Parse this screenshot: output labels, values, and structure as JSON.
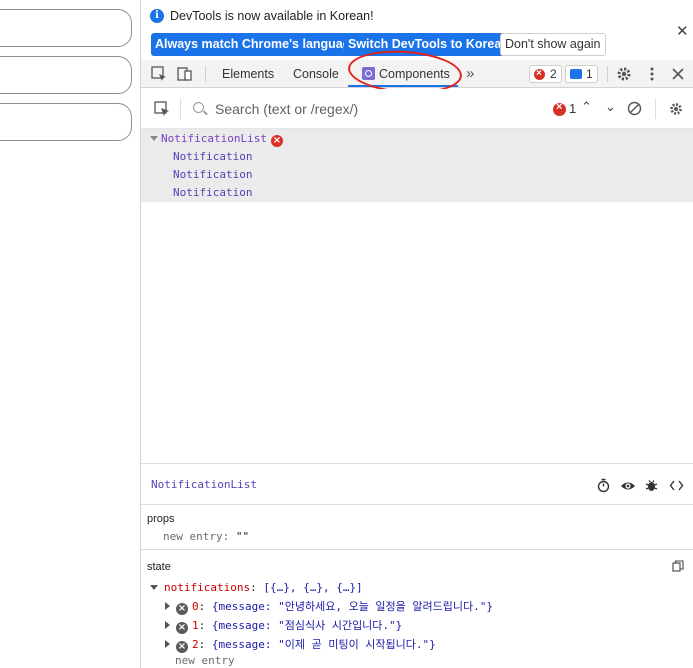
{
  "colors": {
    "accent": "#1a73e8",
    "error": "#d93025",
    "annotation": "#e0211c",
    "component": "#5a3fb4"
  },
  "infobar": {
    "message": "DevTools is now available in Korean!",
    "btn_match": "Always match Chrome's language",
    "btn_switch": "Switch DevTools to Korean",
    "btn_dismiss": "Don't show again",
    "close_icon": "close-icon"
  },
  "toolbar": {
    "tabs": [
      "Elements",
      "Console",
      "Components"
    ],
    "active_tab": "Components",
    "more": "»",
    "error_count": "2",
    "message_count": "1"
  },
  "search": {
    "placeholder": "Search (text or /regex/)",
    "error_count": "1"
  },
  "tree": {
    "root": "NotificationList",
    "children": [
      "Notification",
      "Notification",
      "Notification"
    ]
  },
  "details": {
    "title": "NotificationList",
    "props_label": "props",
    "props_new_entry_key": "new entry",
    "props_new_entry_value": "\"\"",
    "state_label": "state",
    "state_key": "notifications",
    "state_summary": "[{…}, {…}, {…}]",
    "items": [
      {
        "index": "0",
        "text": "{message: \"안녕하세요, 오늘 일정을 알려드립니다.\"}"
      },
      {
        "index": "1",
        "text": "{message: \"점심식사 시간입니다.\"}"
      },
      {
        "index": "2",
        "text": "{message: \"이제 곧 미팅이 시작됩니다.\"}"
      }
    ],
    "state_new_entry": "new entry"
  }
}
